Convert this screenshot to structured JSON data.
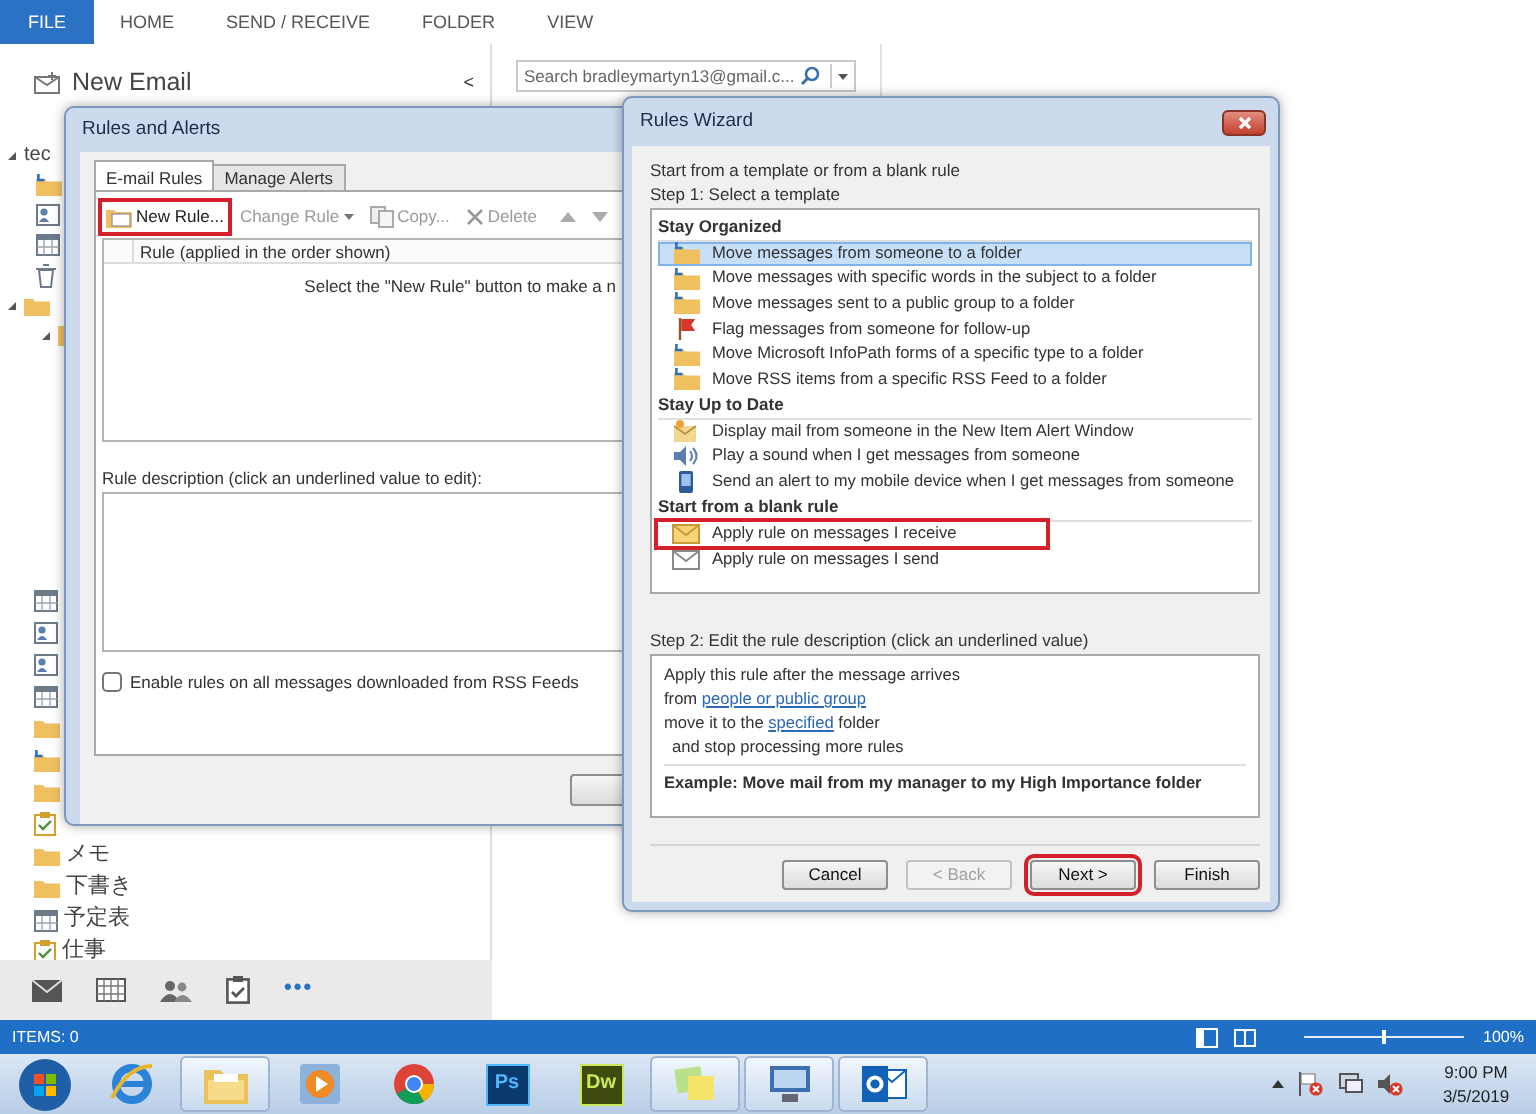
{
  "ribbon": {
    "tabs": [
      {
        "label": "FILE",
        "selected": true
      },
      {
        "label": "HOME",
        "selected": false
      },
      {
        "label": "SEND / RECEIVE",
        "selected": false
      },
      {
        "label": "FOLDER",
        "selected": false
      },
      {
        "label": "VIEW",
        "selected": false
      }
    ]
  },
  "nav_pane": {
    "new_email": "New Email",
    "collapse": "<",
    "account": "tec",
    "folders": [
      {
        "label": "メモ",
        "kind": "folder"
      },
      {
        "label": "下書き",
        "kind": "folder"
      },
      {
        "label": "予定表",
        "kind": "calendar"
      },
      {
        "label": "仕事",
        "kind": "task"
      }
    ],
    "more": "•••"
  },
  "search": {
    "placeholder": "Search bradleymartyn13@gmail.c..."
  },
  "rules_and_alerts": {
    "title": "Rules and Alerts",
    "tabs": [
      {
        "label": "E-mail Rules",
        "selected": true
      },
      {
        "label": "Manage Alerts",
        "selected": false
      }
    ],
    "toolbar": [
      {
        "label": "New Rule...",
        "kind": "new",
        "disabled": false,
        "annotated": true
      },
      {
        "label": "Change Rule",
        "kind": "change",
        "disabled": true,
        "annotated": false
      },
      {
        "label": "Copy...",
        "kind": "copy",
        "disabled": true,
        "annotated": false
      },
      {
        "label": "Delete",
        "kind": "delete",
        "disabled": true,
        "annotated": false
      },
      {
        "kind": "up",
        "disabled": true,
        "annotated": false
      },
      {
        "kind": "down",
        "disabled": true,
        "annotated": false
      }
    ],
    "rule_list": {
      "column": "Rule (applied in the order shown)",
      "empty_message": "Select the \"New Rule\" button to make a n"
    },
    "description_label": "Rule description (click an underlined value to edit):",
    "rss_checkbox": {
      "label": "Enable rules on all messages downloaded from RSS Feeds",
      "checked": false
    }
  },
  "rules_wizard": {
    "title": "Rules Wizard",
    "intro": "Start from a template or from a blank rule",
    "step1": "Step 1: Select a template",
    "groups": [
      {
        "heading": "Stay Organized",
        "items": [
          {
            "label": "Move messages from someone to a folder",
            "kind": "move",
            "selected": true,
            "annotated": false
          },
          {
            "label": "Move messages with specific words in the subject to a folder",
            "kind": "move",
            "selected": false,
            "annotated": false
          },
          {
            "label": "Move messages sent to a public group to a folder",
            "kind": "move",
            "selected": false,
            "annotated": false
          },
          {
            "label": "Flag messages from someone for follow-up",
            "kind": "flag",
            "selected": false,
            "annotated": false
          },
          {
            "label": "Move Microsoft InfoPath forms of a specific type to a folder",
            "kind": "move",
            "selected": false,
            "annotated": false
          },
          {
            "label": "Move RSS items from a specific RSS Feed to a folder",
            "kind": "move",
            "selected": false,
            "annotated": false
          }
        ]
      },
      {
        "heading": "Stay Up to Date",
        "items": [
          {
            "label": "Display mail from someone in the New Item Alert Window",
            "kind": "alert",
            "selected": false,
            "annotated": false
          },
          {
            "label": "Play a sound when I get messages from someone",
            "kind": "sound",
            "selected": false,
            "annotated": false
          },
          {
            "label": "Send an alert to my mobile device when I get messages from someone",
            "kind": "mobile",
            "selected": false,
            "annotated": false
          }
        ]
      },
      {
        "heading": "Start from a blank rule",
        "items": [
          {
            "label": "Apply rule on messages I receive",
            "kind": "receive",
            "selected": false,
            "annotated": true
          },
          {
            "label": "Apply rule on messages I send",
            "kind": "send",
            "selected": false,
            "annotated": false
          }
        ]
      }
    ],
    "step2": "Step 2: Edit the rule description (click an underlined value)",
    "description": [
      {
        "indent": false,
        "parts": [
          {
            "text": "Apply this rule after the message arrives",
            "link": false
          }
        ]
      },
      {
        "indent": false,
        "parts": [
          {
            "text": "from ",
            "link": false
          },
          {
            "text": "people or public group",
            "link": true
          }
        ]
      },
      {
        "indent": false,
        "parts": [
          {
            "text": "move it to the ",
            "link": false
          },
          {
            "text": "specified",
            "link": true
          },
          {
            "text": " folder",
            "link": false
          }
        ]
      },
      {
        "indent": true,
        "parts": [
          {
            "text": "and stop processing more rules",
            "link": false
          }
        ]
      }
    ],
    "example": "Example: Move mail from my manager to my High Importance folder",
    "buttons": [
      {
        "label": "Cancel",
        "disabled": false,
        "annotated": false
      },
      {
        "label": "< Back",
        "disabled": true,
        "annotated": false
      },
      {
        "label": "Next >",
        "disabled": false,
        "annotated": true
      },
      {
        "label": "Finish",
        "disabled": false,
        "annotated": false
      }
    ]
  },
  "status_bar": {
    "items": "ITEMS: 0",
    "zoom_slider": {
      "level": 0.5
    },
    "zoom": "100%"
  },
  "taskbar": {
    "apps": [
      {
        "kind": "ie",
        "active": false
      },
      {
        "kind": "explorer",
        "active": true
      },
      {
        "kind": "media",
        "active": false
      },
      {
        "kind": "chrome",
        "active": false
      },
      {
        "kind": "tile",
        "label": "Ps",
        "active": false
      },
      {
        "kind": "tile",
        "label": "Dw",
        "active": false
      },
      {
        "kind": "notes",
        "active": true
      },
      {
        "kind": "monitor",
        "active": true
      },
      {
        "kind": "outlook",
        "active": true
      }
    ],
    "time": "9:00 PM",
    "date": "3/5/2019"
  }
}
